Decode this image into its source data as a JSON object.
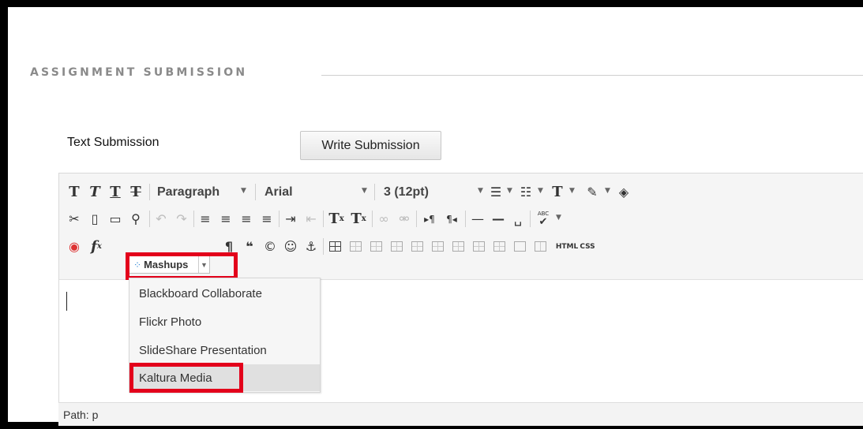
{
  "section": {
    "title": "ASSIGNMENT SUBMISSION"
  },
  "text_submission": {
    "label": "Text Submission",
    "button": "Write Submission"
  },
  "toolbar": {
    "row1": {
      "bold": "T",
      "italic": "T",
      "underline": "T",
      "strike": "T",
      "format": "Paragraph",
      "font": "Arial",
      "size": "3 (12pt)",
      "textcolor": "T"
    },
    "row2": {
      "superscript_sup": "x",
      "subscript_sub": "x",
      "super_base": "T",
      "sub_base": "T",
      "ltr": "▸¶",
      "rtl": "¶◂",
      "spell_abc": "ABC"
    },
    "row3": {
      "mashups": "Mashups",
      "math": "f",
      "math_sub": "x",
      "pilcrow": "¶",
      "quote": "❝",
      "copyright": "©",
      "smiley": "☺",
      "anchor": "⚓",
      "html": "HTML",
      "css": "CSS"
    }
  },
  "mashups_menu": {
    "items": [
      "Blackboard Collaborate",
      "Flickr Photo",
      "SlideShare Presentation",
      "Kaltura Media"
    ],
    "highlighted": "Kaltura Media"
  },
  "pathbar": {
    "text": "Path: p"
  },
  "colors": {
    "annotation_red": "#e3001b",
    "background": "#ffffff"
  }
}
